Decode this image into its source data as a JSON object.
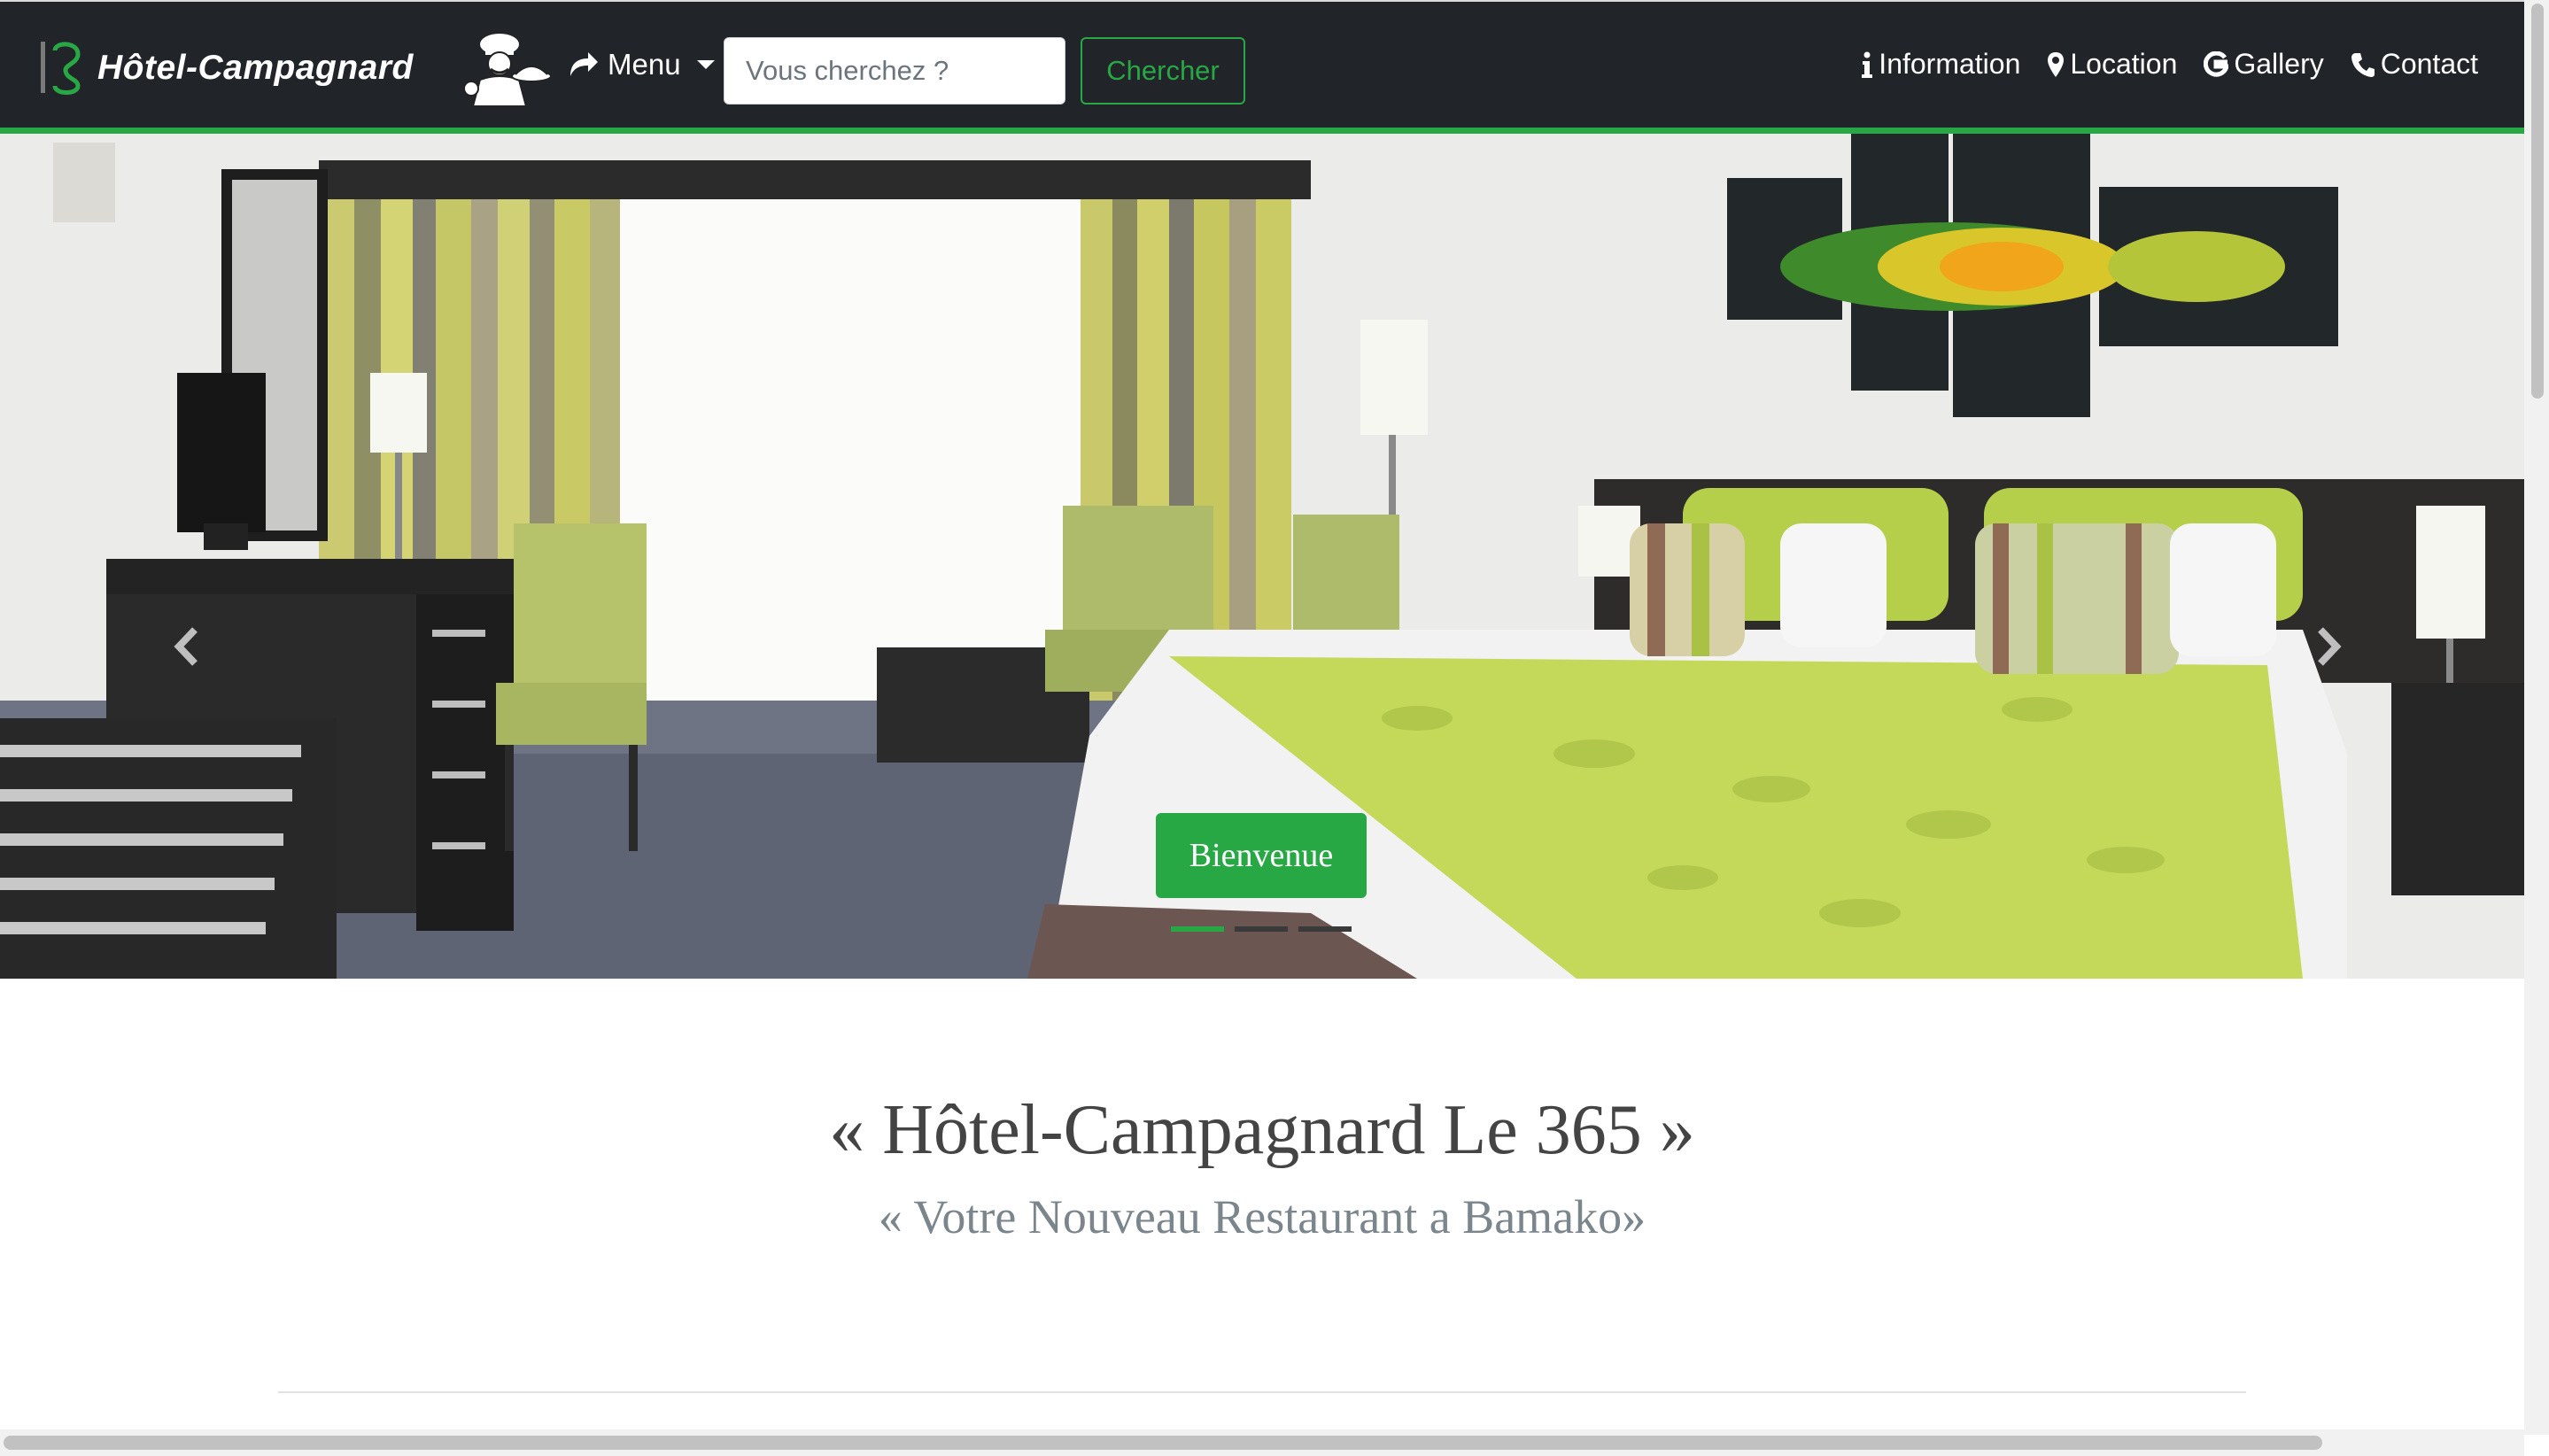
{
  "brand": {
    "name": "Hôtel-Campagnard"
  },
  "nav": {
    "menu_label": "Menu",
    "search": {
      "placeholder": "Vous cherchez ?",
      "value": ""
    },
    "search_button": "Chercher",
    "links": [
      {
        "icon": "info-icon",
        "label": "Information"
      },
      {
        "icon": "map-marker-icon",
        "label": "Location"
      },
      {
        "icon": "google-icon",
        "label": "Gallery"
      },
      {
        "icon": "phone-icon",
        "label": "Contact"
      }
    ]
  },
  "carousel": {
    "caption_button": "Bienvenue",
    "active_index": 0,
    "slide_count": 3
  },
  "main": {
    "title": "« Hôtel-Campagnard Le 365 »",
    "subtitle": "« Votre Nouveau Restaurant a Bamako»"
  },
  "colors": {
    "navbar_bg": "#212529",
    "accent": "#28a745",
    "text": "#444444",
    "muted": "#7b858c"
  }
}
